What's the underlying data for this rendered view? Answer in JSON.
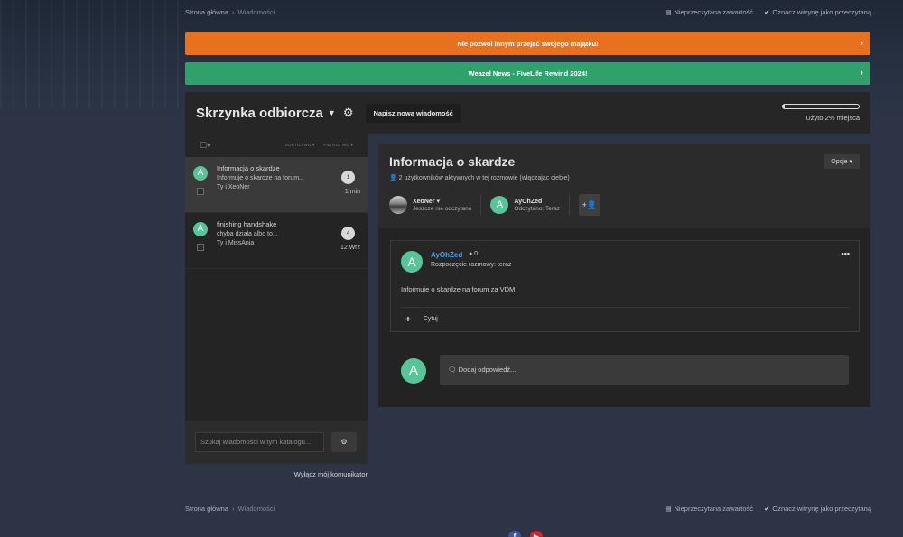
{
  "breadcrumb": {
    "home": "Strona główna",
    "sep": "›",
    "current": "Wiadomości"
  },
  "top_links": {
    "unread": "Nieprzeczytana zawartość",
    "mark_read": "Oznacz witrynę jako przeczytaną"
  },
  "banners": [
    {
      "text": "Nie pozwól innym przejąć swojego majątku!",
      "color": "#e8711f"
    },
    {
      "text": "Weazel News - FiveLife Rewind 2024!",
      "color": "#2fa26c"
    }
  ],
  "inbox": {
    "title": "Skrzynka odbiorcza",
    "new_message": "Napisz nową wiadomość",
    "quota_label": "Użyto 2% miejsca",
    "quota_used": 0.02
  },
  "list_tools": {
    "sort": "SORTUJ WG ▾",
    "filter": "FILTRUJ WG ▾"
  },
  "conversations": [
    {
      "avatar": "A",
      "title": "Informacja o skardze",
      "preview": "Informuje o skardze na forum...",
      "participants": "Ty i XeoNer",
      "count": "1",
      "time": "1 min",
      "active": true
    },
    {
      "avatar": "A",
      "title": "finishing handshake",
      "preview": "chyba dziala albo to...",
      "participants": "Ty i MissAnia",
      "count": "4",
      "time": "12 Wrz",
      "active": false
    }
  ],
  "search": {
    "placeholder": "Szukaj wiadomości w tym katalogu..."
  },
  "disable_messenger": "Wyłącz mój komunikator",
  "conversation": {
    "title": "Informacja o skardze",
    "subtitle": "2 użytkowników aktywnych w tej rozmowie (włączając ciebie)",
    "options": "Opcje ▾",
    "participants": [
      {
        "name": "XeoNer ▾",
        "status": "Jeszcze nie odczytano"
      },
      {
        "avatar": "A",
        "name": "AyOhZed",
        "status": "Odczytano: Teraz"
      }
    ],
    "add_participant": "+👤",
    "message": {
      "avatar": "A",
      "author": "AyOhZed",
      "reputation": "● 0",
      "started": "Rozpoczęcie rozmowy: teraz",
      "body": "Informuje o skardze na forum za VDM",
      "plus": "✚",
      "quote": "Cytuj",
      "more": "•••"
    },
    "reply": {
      "avatar": "A",
      "placeholder": "🗨 Dodaj odpowiedź..."
    }
  },
  "social": {
    "facebook": "f",
    "youtube": "▶"
  }
}
